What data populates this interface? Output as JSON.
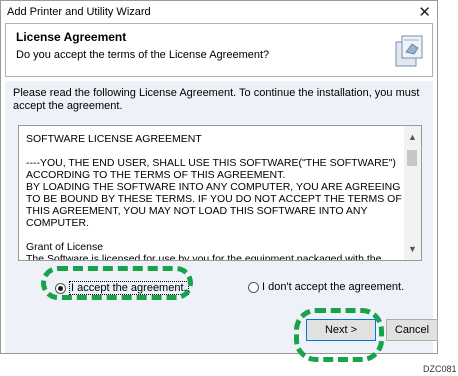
{
  "window": {
    "title": "Add Printer and Utility Wizard",
    "close_glyph": "✕"
  },
  "header": {
    "title": "License Agreement",
    "subtitle": "Do you accept the terms of the License Agreement?",
    "icon": "document-seal-icon"
  },
  "intro_text": "Please read the following License Agreement. To continue the installation, you must accept the agreement.",
  "license": {
    "heading": "SOFTWARE LICENSE AGREEMENT",
    "para1": "----YOU, THE END USER, SHALL USE THIS SOFTWARE(\"THE SOFTWARE\") ACCORDING TO THE TERMS OF THIS AGREEMENT.\nBY LOADING THE SOFTWARE INTO ANY COMPUTER, YOU ARE AGREEING TO BE BOUND BY THESE TERMS. IF YOU DO NOT ACCEPT THE TERMS OF THIS AGREEMENT, YOU MAY NOT LOAD THIS SOFTWARE INTO ANY COMPUTER.",
    "para2": "Grant of License\nThe Software is licensed for use by you for the equipment packaged with the Software"
  },
  "options": {
    "accept_label": "I accept the agreement.",
    "reject_label": "I don't accept the agreement.",
    "selected": "accept"
  },
  "buttons": {
    "next_label": "Next >",
    "cancel_label": "Cancel"
  },
  "caption": "DZC081"
}
